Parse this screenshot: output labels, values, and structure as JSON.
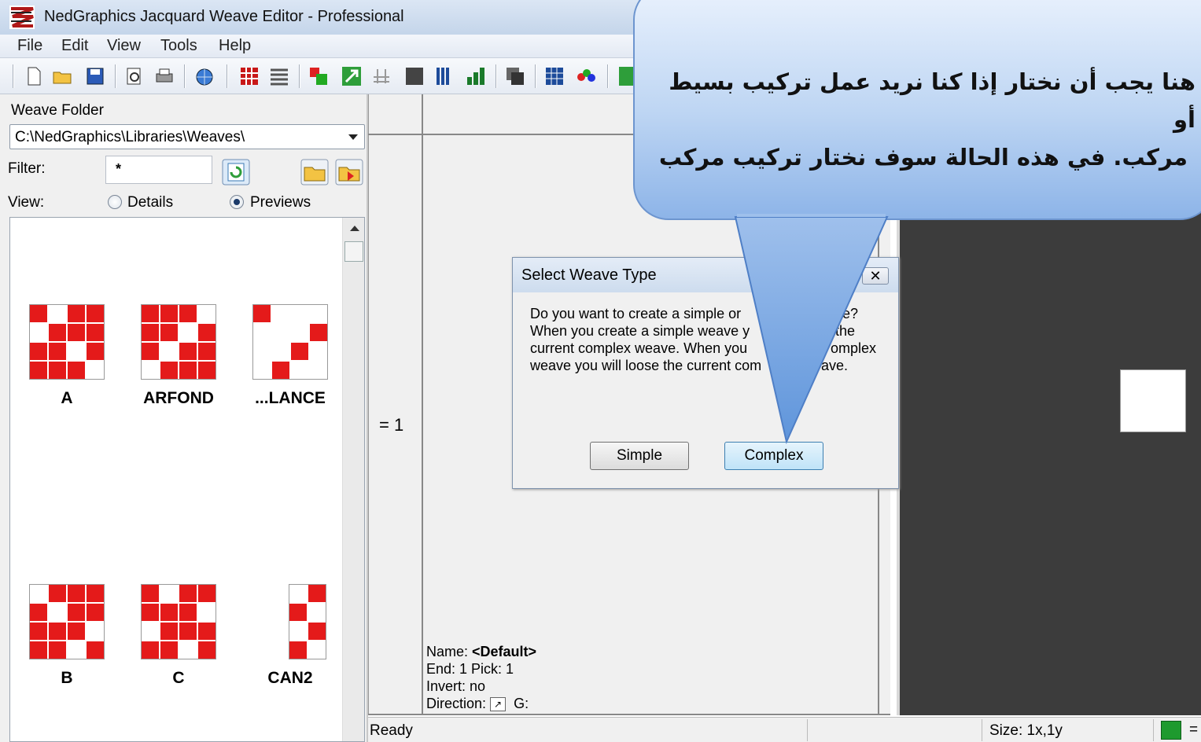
{
  "window": {
    "title": "NedGraphics Jacquard Weave Editor - Professional"
  },
  "menu": [
    "File",
    "Edit",
    "View",
    "Tools",
    "Help"
  ],
  "toolbar": {
    "icons": [
      "new-file-icon",
      "open-folder-icon",
      "save-icon",
      "print-preview-icon",
      "print-icon",
      "globe-icon",
      "weave-grid-icon",
      "list-icon",
      "color-swap-icon",
      "arrow-icon",
      "fabric-icon",
      "square-icon",
      "columns-icon",
      "chart-icon",
      "copy-icon",
      "table-icon",
      "balls-icon",
      "check-icon"
    ]
  },
  "left_panel": {
    "folder_label": "Weave Folder",
    "folder_value": "C:\\NedGraphics\\Libraries\\Weaves\\",
    "filter_label": "Filter:",
    "filter_value": "*",
    "view_label": "View:",
    "view_options": [
      {
        "label": "Details",
        "selected": false
      },
      {
        "label": "Previews",
        "selected": true
      }
    ],
    "weaves": [
      {
        "name": "A",
        "cols": 4,
        "rows": 4,
        "cells": "rwrr wrrr rrwr rrrw"
      },
      {
        "name": "ARFOND",
        "cols": 4,
        "rows": 4,
        "cells": "rrrw rrwr rwrr wrrr"
      },
      {
        "name": "...LANCE",
        "cols": 4,
        "rows": 4,
        "cells": "rwww wwwr wwrw wrww"
      },
      {
        "name": "B",
        "cols": 4,
        "rows": 4,
        "cells": "wrrr rwrr rrrw rrwr"
      },
      {
        "name": "C",
        "cols": 4,
        "rows": 4,
        "cells": "rwrr rrrw wrrr rrwr"
      },
      {
        "name": "CAN2",
        "cols": 2,
        "rows": 4,
        "cells": "wr rw wr rw"
      }
    ]
  },
  "editor": {
    "ratio": "= 1",
    "info": {
      "name_label": "Name:",
      "name_value": "<Default>",
      "end_pick": "End: 1 Pick: 1",
      "invert": "Invert: no",
      "direction_label": "Direction:",
      "g_label": "G:"
    }
  },
  "dialog": {
    "title": "Select Weave Type",
    "close_symbol": "✕",
    "message_lines": [
      "Do you want to create a simple or ",
      "When you create a simple weave y",
      "current complex weave. When you",
      "weave you will loose the current com"
    ],
    "message_right": [
      "ave?",
      "the",
      "omplex",
      "ave."
    ],
    "buttons": {
      "simple": "Simple",
      "complex": "Complex"
    }
  },
  "callout": {
    "lines": [
      "هنا يجب أن نختار إذا كنا نريد عمل تركيب بسيط أو",
      "مركب. في هذه الحالة سوف نختار تركيب مركب"
    ]
  },
  "status": {
    "ready": "Ready",
    "size": "Size: 1x,1y",
    "eq": "="
  },
  "colors": {
    "weave_red": "#e41a1a",
    "dark_panel": "#3c3c3c",
    "callout_blue": "#a9c8f0"
  }
}
